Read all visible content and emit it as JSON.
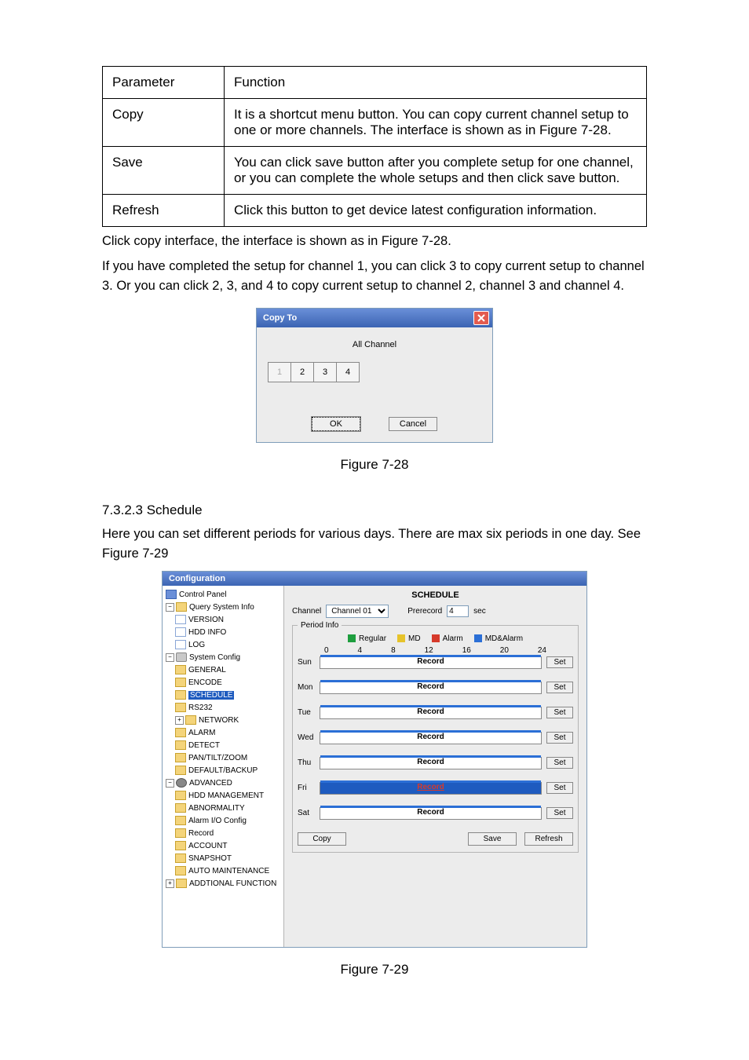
{
  "param_table": {
    "headers": [
      "Parameter",
      "Function"
    ],
    "rows": [
      {
        "param": "Copy",
        "func": "It is a shortcut menu button. You can copy current channel setup to one or more channels.  The interface is shown as in Figure 7-28."
      },
      {
        "param": "Save",
        "func": "You can click save button after you complete setup for one channel, or you can complete the whole setups and then click save button."
      },
      {
        "param": "Refresh",
        "func": "Click this button to get device latest configuration information."
      }
    ]
  },
  "body_paragraphs": [
    "Click copy interface, the interface is shown as in Figure 7-28.",
    "If you have completed the setup for channel 1, you can click 3 to copy current setup to channel 3. Or you can click 2, 3, and 4 to copy current setup to channel 2, channel 3 and channel 4."
  ],
  "figure_captions": {
    "fig28": "Figure 7-28",
    "fig29": "Figure 7-29"
  },
  "copy_dialog": {
    "title": "Copy To",
    "all_channel": "All Channel",
    "channels": [
      "1",
      "2",
      "3",
      "4"
    ],
    "ok": "OK",
    "cancel": "Cancel"
  },
  "section_heading": "7.3.2.3  Schedule",
  "section_body": "Here you can set different periods for various days. There are max six periods in one day. See Figure 7-29",
  "config_window": {
    "title": "Configuration",
    "tree": {
      "control_panel": "Control Panel",
      "query_system_info": "Query System Info",
      "version": "VERSION",
      "hdd_info": "HDD INFO",
      "log": "LOG",
      "system_config": "System Config",
      "general": "GENERAL",
      "encode": "ENCODE",
      "schedule": "SCHEDULE",
      "rs232": "RS232",
      "network": "NETWORK",
      "alarm": "ALARM",
      "detect": "DETECT",
      "ptz": "PAN/TILT/ZOOM",
      "default_backup": "DEFAULT/BACKUP",
      "advanced": "ADVANCED",
      "hdd_management": "HDD MANAGEMENT",
      "abnormality": "ABNORMALITY",
      "alarm_io": "Alarm I/O Config",
      "record": "Record",
      "account": "ACCOUNT",
      "snapshot": "SNAPSHOT",
      "auto_maintenance": "AUTO MAINTENANCE",
      "additional_function": "ADDTIONAL FUNCTION"
    },
    "schedule_panel": {
      "title": "SCHEDULE",
      "channel_label": "Channel",
      "channel_value": "Channel 01",
      "prerecord_label": "Prerecord",
      "prerecord_value": "4",
      "prerecord_unit": "sec",
      "period_info": "Period Info",
      "legend": {
        "regular": "Regular",
        "md": "MD",
        "alarm": "Alarm",
        "md_alarm": "MD&Alarm"
      },
      "hours": [
        "0",
        "4",
        "8",
        "12",
        "16",
        "20",
        "24"
      ],
      "days": [
        "Sun",
        "Mon",
        "Tue",
        "Wed",
        "Thu",
        "Fri",
        "Sat"
      ],
      "record_label": "Record",
      "set_label": "Set",
      "copy": "Copy",
      "save": "Save",
      "refresh": "Refresh"
    }
  }
}
